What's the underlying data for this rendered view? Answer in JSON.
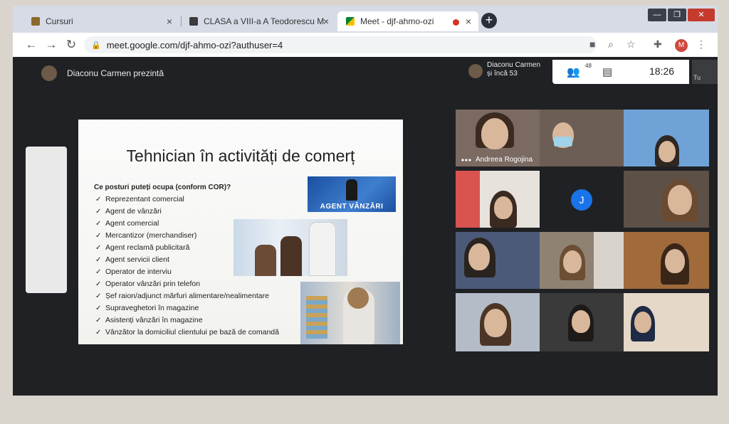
{
  "tabs": [
    {
      "title": "Cursuri",
      "close": "×"
    },
    {
      "title": "CLASA a VIII-a A Teodorescu Mi",
      "close": "×"
    },
    {
      "title": "Meet - djf-ahmo-ozi",
      "close": "×"
    }
  ],
  "new_tab_label": "+",
  "window_controls": {
    "minimize": "—",
    "maximize": "❐",
    "close": "✕"
  },
  "address": {
    "url": "meet.google.com/djf-ahmo-ozi?authuser=4",
    "lock": "🔒"
  },
  "nav": {
    "back": "←",
    "forward": "→",
    "reload": "↻"
  },
  "toolbar_icons": {
    "camera": "■",
    "zoom": "⌕",
    "star": "☆",
    "extensions": "✚",
    "menu": "⋮"
  },
  "profile_initial": "M",
  "meet": {
    "presenter_text": "Diaconu Carmen prezintă",
    "participants_name": "Diaconu Carmen",
    "participants_more": "și încă 53",
    "participants_count_badge": "48",
    "time": "18:26",
    "self_label": "Tu"
  },
  "slide": {
    "title": "Tehnician în activități de comerț",
    "question": "Ce posturi puteți ocupa (conform COR)?",
    "check_glyph": "✓",
    "items": [
      "Reprezentant comercial",
      "Agent de vânzări",
      "Agent comercial",
      "Mercantizor (merchandiser)",
      "Agent reclamă publicitară",
      "Agent servicii client",
      "Operator de interviu",
      "Operator vânzări prin telefon",
      "Șef raion/adjunct mărfuri alimentare/nealimentare",
      "Supraveghetori în magazine",
      "Asistenți vânzări în magazine",
      "Vânzător la domiciliul clientului pe bază de comandă"
    ],
    "agent_image_label": "AGENT VÂNZĂRI"
  },
  "grid": {
    "named_participant": "Andreea Rogojina",
    "initial_tile_letter": "J"
  }
}
